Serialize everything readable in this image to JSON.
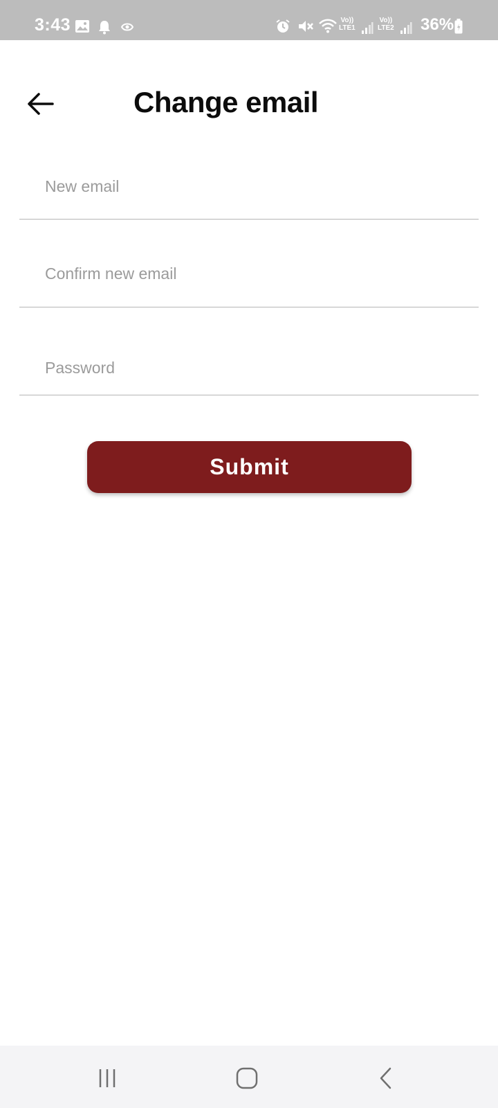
{
  "status_bar": {
    "time": "3:43",
    "battery": "36%",
    "sim1": "LTE1",
    "sim2": "LTE2",
    "volte1": "Vo))",
    "volte2": "Vo))",
    "icons": [
      "gallery-icon",
      "notification-bell-icon",
      "app-icon",
      "alarm-icon",
      "mute-icon",
      "wifi-icon",
      "signal-icon",
      "signal-icon",
      "battery-icon"
    ]
  },
  "header": {
    "title": "Change email",
    "back_icon": "arrow-left-icon"
  },
  "form": {
    "new_email_placeholder": "New email",
    "confirm_email_placeholder": "Confirm new email",
    "password_placeholder": "Password",
    "submit_label": "Submit"
  },
  "colors": {
    "accent": "#7e1c1d",
    "status_bar_bg": "#bcbcbc",
    "nav_bar_bg": "#f4f4f6",
    "placeholder": "#9b9b9b",
    "divider": "#b5b5b5"
  },
  "nav_bar": {
    "icons": [
      "recent-apps-icon",
      "home-icon",
      "back-icon"
    ]
  }
}
